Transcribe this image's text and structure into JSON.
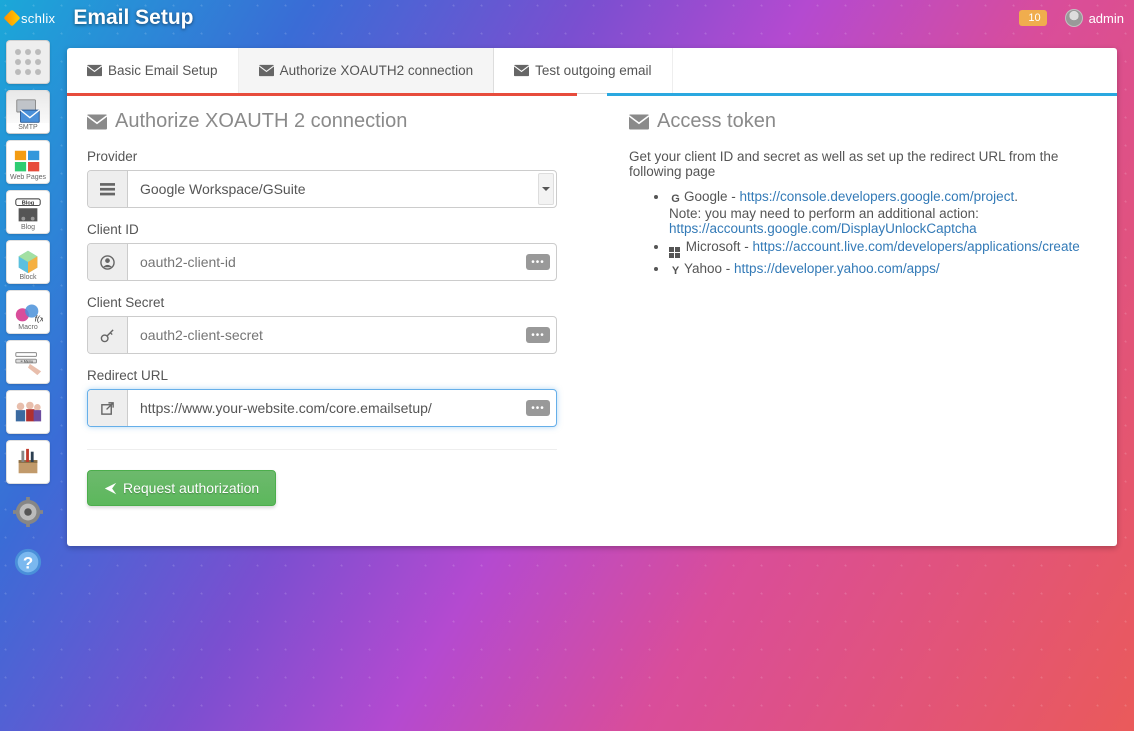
{
  "brand": "schlix",
  "page_title": "Email Setup",
  "notif_count": "10",
  "username": "admin",
  "side_rail": [
    {
      "name": "apps",
      "label": ""
    },
    {
      "name": "smtp",
      "label": "SMTP"
    },
    {
      "name": "webpages",
      "label": "Web Pages"
    },
    {
      "name": "blog",
      "label": "Blog"
    },
    {
      "name": "block",
      "label": "Block"
    },
    {
      "name": "macro",
      "label": "Macro"
    },
    {
      "name": "menu",
      "label": "Menu"
    },
    {
      "name": "users",
      "label": ""
    },
    {
      "name": "tools",
      "label": ""
    },
    {
      "name": "settings",
      "label": ""
    },
    {
      "name": "help",
      "label": ""
    }
  ],
  "tabs": {
    "basic": "Basic Email Setup",
    "authorize": "Authorize XOAUTH2 connection",
    "test": "Test outgoing email"
  },
  "left": {
    "heading": "Authorize XOAUTH 2 connection",
    "provider_label": "Provider",
    "provider_value": "Google Workspace/GSuite",
    "client_id_label": "Client ID",
    "client_id_placeholder": "oauth2-client-id",
    "client_secret_label": "Client Secret",
    "client_secret_placeholder": "oauth2-client-secret",
    "redirect_label": "Redirect URL",
    "redirect_value": "https://www.your-website.com/core.emailsetup/",
    "request_btn": "Request authorization"
  },
  "right": {
    "heading": "Access token",
    "desc": "Get your client ID and secret as well as set up the redirect URL from the following page",
    "google_name": "Google - ",
    "google_link": "https://console.developers.google.com/project",
    "google_note": "Note: you may need to perform an additional action: ",
    "google_note_link": "https://accounts.google.com/DisplayUnlockCaptcha",
    "ms_name": "Microsoft - ",
    "ms_link": "https://account.live.com/developers/applications/create",
    "yahoo_name": "Yahoo - ",
    "yahoo_link": "https://developer.yahoo.com/apps/"
  }
}
